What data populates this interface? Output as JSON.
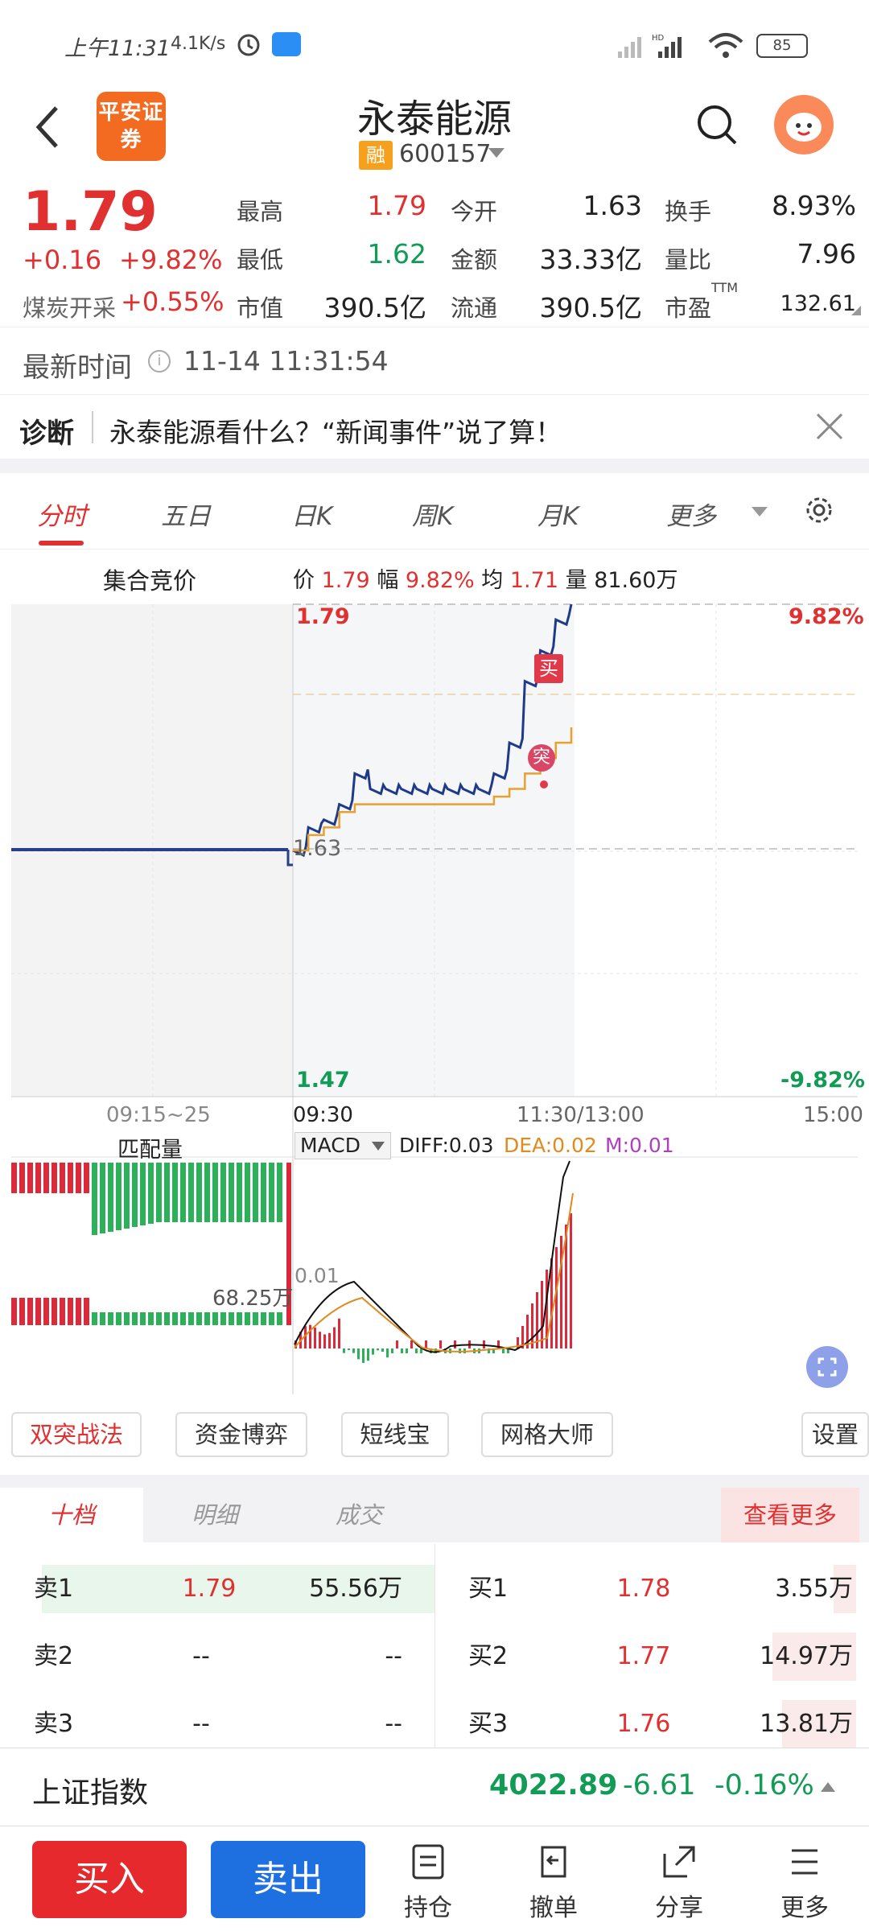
{
  "status": {
    "time": "上午11:31",
    "speed": "4.1K/s",
    "battery": "85"
  },
  "header": {
    "broker_logo": "平安证券",
    "title": "永泰能源",
    "badge": "融",
    "code": "600157"
  },
  "quote": {
    "price": "1.79",
    "change": "+0.16",
    "change_pct": "+9.82%",
    "sector": "煤炭开采",
    "sector_pct": "+0.55%",
    "fields": [
      {
        "label": "最高",
        "value": "1.79",
        "color": "#e03030"
      },
      {
        "label": "今开",
        "value": "1.63",
        "color": "#222222"
      },
      {
        "label": "换手",
        "value": "8.93%",
        "color": "#222222"
      },
      {
        "label": "最低",
        "value": "1.62",
        "color": "#119b55"
      },
      {
        "label": "金额",
        "value": "33.33亿",
        "color": "#222222"
      },
      {
        "label": "量比",
        "value": "7.96",
        "color": "#222222"
      },
      {
        "label": "市值",
        "value": "390.5亿",
        "color": "#222222"
      },
      {
        "label": "流通",
        "value": "390.5亿",
        "color": "#222222"
      },
      {
        "label": "市盈",
        "value": "132.61",
        "color": "#222222"
      }
    ],
    "ttm": "TTM"
  },
  "time_row": {
    "label": "最新时间",
    "value": "11-14 11:31:54"
  },
  "diagnosis": {
    "label": "诊断",
    "text": "永泰能源看什么？“新闻事件”说了算！"
  },
  "tabs": [
    "分时",
    "五日",
    "日K",
    "周K",
    "月K",
    "更多"
  ],
  "chart": {
    "auction_label": "集合竞价",
    "info": {
      "price_l": "价",
      "price": "1.79",
      "amp_l": "幅",
      "amp": "9.82%",
      "avg_l": "均",
      "avg": "1.71",
      "vol_l": "量",
      "vol": "81.60万"
    },
    "y_top": "1.79",
    "y_mid": "1.63",
    "y_bot": "1.47",
    "pct_top": "9.82%",
    "pct_bot": "-9.82%",
    "times": [
      "09:15~25",
      "09:30",
      "11:30/13:00",
      "15:00"
    ],
    "marker_buy": "买",
    "marker_break": "突",
    "match_label": "匹配量",
    "match_value": "68.25万",
    "macd_sel": "MACD",
    "diff": "DIFF:0.03",
    "dea": "DEA:0.02",
    "m": "M:0.01",
    "macd_axis": "0.01"
  },
  "chart_data": {
    "type": "line",
    "x": [
      "09:30",
      "09:35",
      "09:40",
      "09:45",
      "09:50",
      "09:55",
      "10:00",
      "10:10",
      "10:20",
      "10:30",
      "10:40",
      "10:50",
      "11:00",
      "11:05",
      "11:10",
      "11:15",
      "11:20",
      "11:25",
      "11:30"
    ],
    "series": [
      {
        "name": "价",
        "values": [
          1.63,
          1.645,
          1.65,
          1.66,
          1.68,
          1.67,
          1.67,
          1.67,
          1.67,
          1.67,
          1.67,
          1.67,
          1.67,
          1.68,
          1.7,
          1.74,
          1.76,
          1.78,
          1.79
        ]
      },
      {
        "name": "均",
        "values": [
          1.63,
          1.64,
          1.645,
          1.655,
          1.66,
          1.66,
          1.66,
          1.66,
          1.66,
          1.66,
          1.66,
          1.66,
          1.66,
          1.665,
          1.67,
          1.68,
          1.69,
          1.7,
          1.71
        ]
      }
    ],
    "ylim": [
      1.47,
      1.79
    ]
  },
  "tools": [
    "双突战法",
    "资金博弈",
    "短线宝",
    "网格大师",
    "设置"
  ],
  "orderbook": {
    "tabs": [
      "十档",
      "明细",
      "成交"
    ],
    "more": "查看更多",
    "sells": [
      {
        "label": "卖1",
        "price": "1.79",
        "vol": "55.56万"
      },
      {
        "label": "卖2",
        "price": "--",
        "vol": "--"
      },
      {
        "label": "卖3",
        "price": "--",
        "vol": "--"
      }
    ],
    "buys": [
      {
        "label": "买1",
        "price": "1.78",
        "vol": "3.55万"
      },
      {
        "label": "买2",
        "price": "1.77",
        "vol": "14.97万"
      },
      {
        "label": "买3",
        "price": "1.76",
        "vol": "13.81万"
      }
    ]
  },
  "index": {
    "name": "上证指数",
    "value": "4022.89",
    "change": "-6.61",
    "pct": "-0.16%"
  },
  "bottom": {
    "buy": "买入",
    "sell": "卖出",
    "nav": [
      "持仓",
      "撤单",
      "分享",
      "更多"
    ]
  }
}
